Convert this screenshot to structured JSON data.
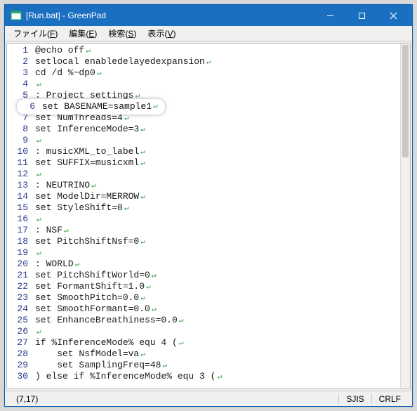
{
  "window": {
    "title": "[Run.bat] - GreenPad"
  },
  "menu": {
    "file": {
      "label": "ファイル",
      "accel": "F"
    },
    "edit": {
      "label": "編集",
      "accel": "E"
    },
    "search": {
      "label": "検索",
      "accel": "S"
    },
    "view": {
      "label": "表示",
      "accel": "V"
    }
  },
  "highlight": {
    "line_no": "6",
    "text": "set BASENAME=sample1"
  },
  "code": {
    "lines": [
      {
        "n": "1",
        "t": "@echo off"
      },
      {
        "n": "2",
        "t": "setlocal enabledelayedexpansion"
      },
      {
        "n": "3",
        "t": "cd /d %~dp0"
      },
      {
        "n": "4",
        "t": ""
      },
      {
        "n": "5",
        "t": ": Project settings"
      },
      {
        "n": "6",
        "t": "set BASENAME=sample1"
      },
      {
        "n": "7",
        "t": "set NumThreads=4"
      },
      {
        "n": "8",
        "t": "set InferenceMode=3"
      },
      {
        "n": "9",
        "t": ""
      },
      {
        "n": "10",
        "t": ": musicXML_to_label"
      },
      {
        "n": "11",
        "t": "set SUFFIX=musicxml"
      },
      {
        "n": "12",
        "t": ""
      },
      {
        "n": "13",
        "t": ": NEUTRINO"
      },
      {
        "n": "14",
        "t": "set ModelDir=MERROW"
      },
      {
        "n": "15",
        "t": "set StyleShift=0"
      },
      {
        "n": "16",
        "t": ""
      },
      {
        "n": "17",
        "t": ": NSF"
      },
      {
        "n": "18",
        "t": "set PitchShiftNsf=0"
      },
      {
        "n": "19",
        "t": ""
      },
      {
        "n": "20",
        "t": ": WORLD"
      },
      {
        "n": "21",
        "t": "set PitchShiftWorld=0"
      },
      {
        "n": "22",
        "t": "set FormantShift=1.0"
      },
      {
        "n": "23",
        "t": "set SmoothPitch=0.0"
      },
      {
        "n": "24",
        "t": "set SmoothFormant=0.0"
      },
      {
        "n": "25",
        "t": "set EnhanceBreathiness=0.0"
      },
      {
        "n": "26",
        "t": ""
      },
      {
        "n": "27",
        "t": "if %InferenceMode% equ 4 ("
      },
      {
        "n": "28",
        "t": "    set NsfModel=va"
      },
      {
        "n": "29",
        "t": "    set SamplingFreq=48"
      },
      {
        "n": "30",
        "t": ") else if %InferenceMode% equ 3 ("
      }
    ]
  },
  "status": {
    "pos": "(7,17)",
    "encoding": "SJIS",
    "eol": "CRLF"
  }
}
